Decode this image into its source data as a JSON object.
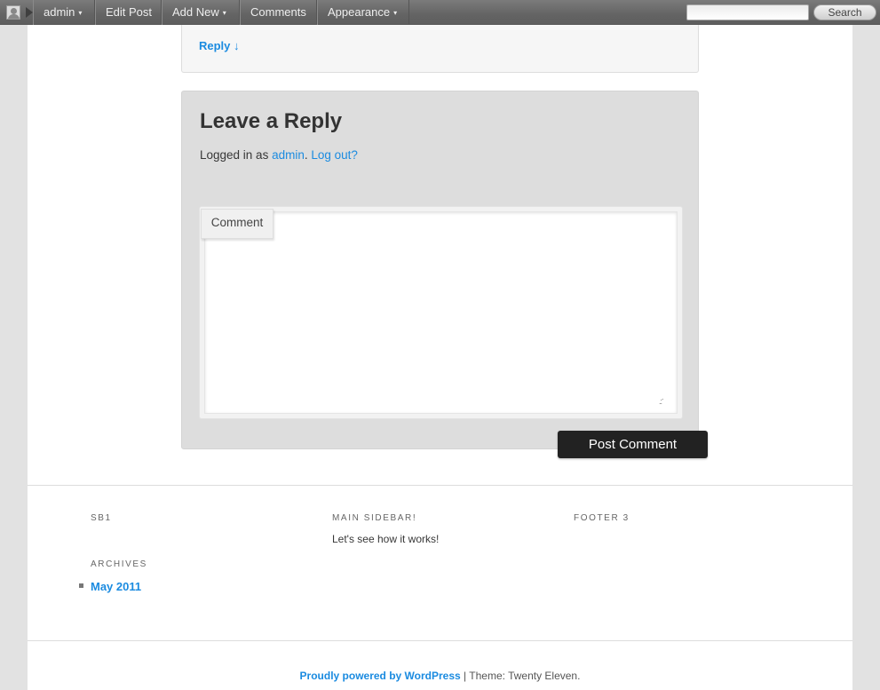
{
  "adminbar": {
    "items": [
      {
        "label": "admin",
        "has_arrow": true
      },
      {
        "label": "Edit Post",
        "has_arrow": false
      },
      {
        "label": "Add New",
        "has_arrow": true
      },
      {
        "label": "Comments",
        "has_arrow": false
      },
      {
        "label": "Appearance",
        "has_arrow": true
      }
    ],
    "search_placeholder": "",
    "search_button": "Search",
    "icons": {
      "avatar": "user-avatar-icon",
      "dropdown": "▾"
    }
  },
  "comment_reply": {
    "link": "Reply ↓"
  },
  "respond": {
    "title": "Leave a Reply",
    "logged_in_prefix": "Logged in as ",
    "user_link": "admin",
    "dot": ".",
    "logout_link": "Log out?",
    "comment_label": "Comment",
    "comment_value": "",
    "submit_label": "Post Comment"
  },
  "footer_widgets": {
    "sb1_title": "SB1",
    "archives_title": "ARCHIVES",
    "archives_items": [
      "May 2011"
    ],
    "main_sidebar_title": "MAIN SIDEBAR!",
    "main_sidebar_text": "Let's see how it works!",
    "footer3_title": "FOOTER 3"
  },
  "site_generator": {
    "powered_by": "Proudly powered by WordPress",
    "separator": " | ",
    "theme": "Theme: Twenty Eleven."
  },
  "colors": {
    "link": "#1b8be0",
    "button": "#222222",
    "adminbar": "#646464"
  }
}
